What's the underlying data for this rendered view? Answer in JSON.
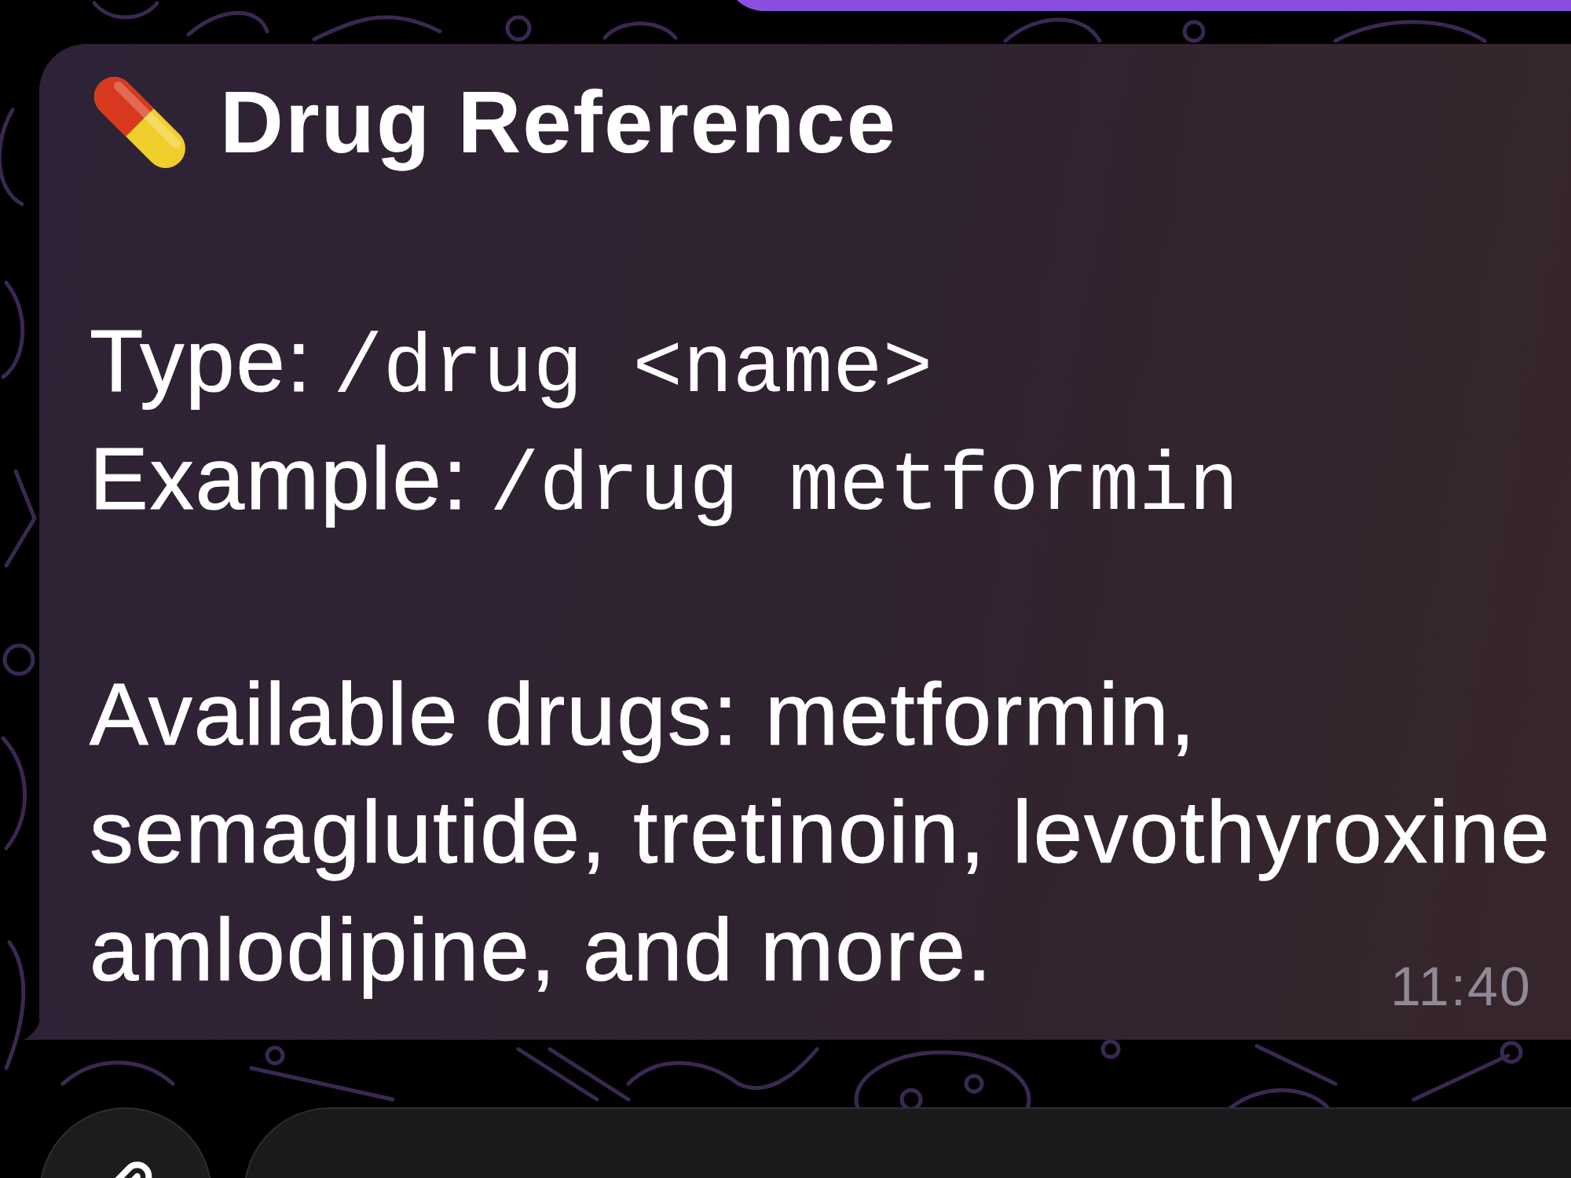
{
  "message": {
    "title": "Drug Reference",
    "commands": [
      {
        "label": "Type:",
        "code": "/drug <name>"
      },
      {
        "label": "Example:",
        "code": "/drug metformin"
      }
    ],
    "lines": [
      "Available drugs: metformin,",
      "semaglutide, tretinoin, levothyroxine",
      "amlodipine, and more."
    ],
    "time": "11:40"
  }
}
